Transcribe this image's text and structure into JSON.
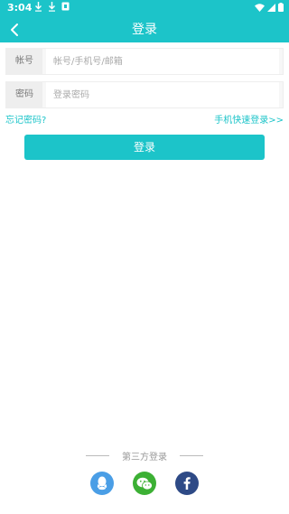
{
  "status_bar": {
    "time": "3:04"
  },
  "header": {
    "title": "登录",
    "back_icon": "chevron-left-icon"
  },
  "form": {
    "account": {
      "label": "帐号",
      "placeholder": "帐号/手机号/邮箱",
      "value": ""
    },
    "password": {
      "label": "密码",
      "placeholder": "登录密码",
      "value": ""
    },
    "forgot_password": "忘记密码?",
    "quick_login": "手机快速登录>>",
    "submit_label": "登录"
  },
  "third_party": {
    "label": "第三方登录",
    "providers": [
      "qq-icon",
      "wechat-icon",
      "facebook-icon"
    ]
  },
  "colors": {
    "accent": "#1cc4c9",
    "qq": "#4a9ee6",
    "wechat": "#3cb034",
    "facebook": "#2e4a86"
  }
}
